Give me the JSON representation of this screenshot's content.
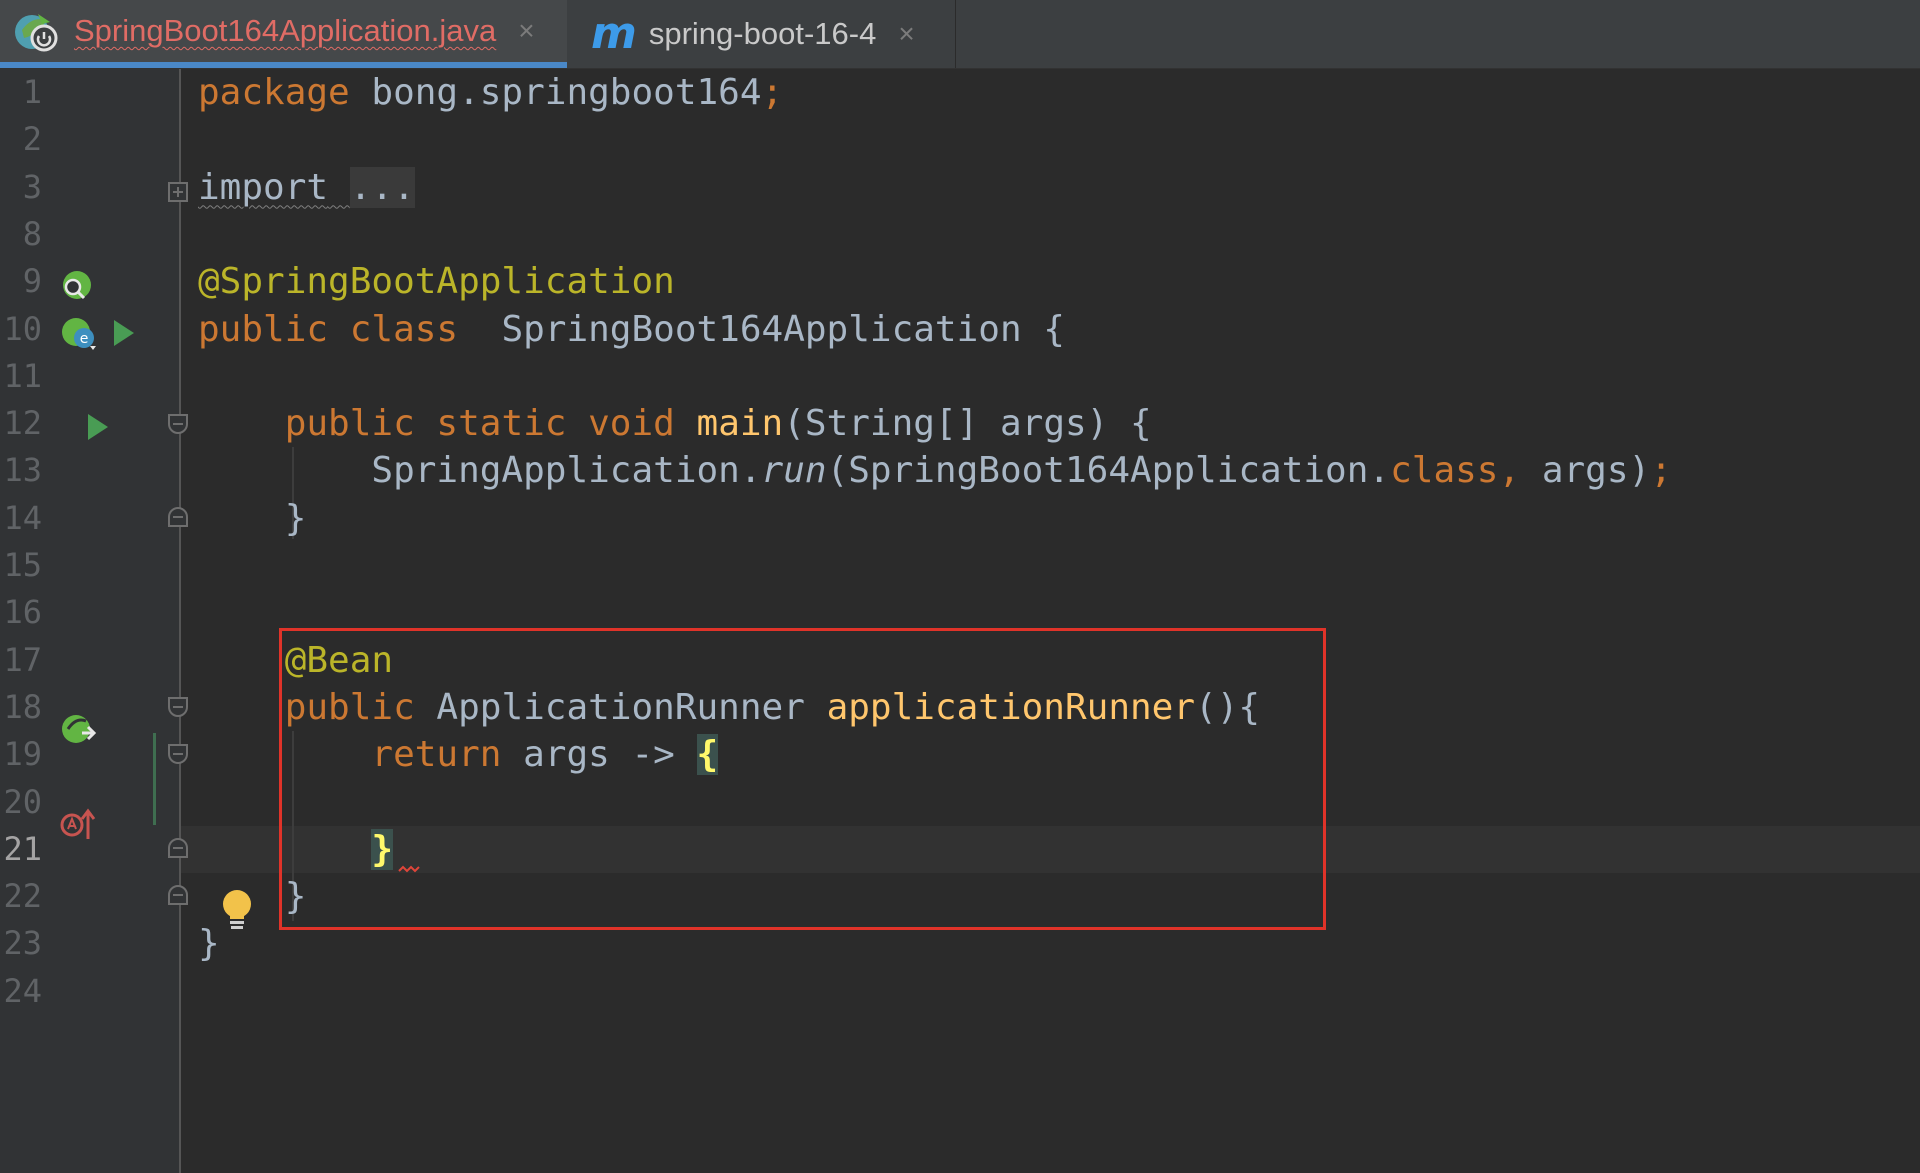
{
  "tabs": [
    {
      "title": "SpringBoot164Application.java",
      "icon": "spring-boot-app-icon",
      "active": true,
      "has_error": true,
      "title_color": "#e06c65"
    },
    {
      "title": "spring-boot-16-4",
      "icon": "maven-m-icon",
      "icon_glyph": "m",
      "active": false
    }
  ],
  "close_glyph": "×",
  "editor": {
    "current_line": 21,
    "line_numbers": [
      "1",
      "2",
      "3",
      "8",
      "9",
      "10",
      "11",
      "12",
      "13",
      "14",
      "15",
      "16",
      "17",
      "18",
      "19",
      "20",
      "21",
      "22",
      "23",
      "24"
    ],
    "code": {
      "l1": {
        "kw": "package",
        "rest": " bong.springboot164",
        "semi": ";"
      },
      "l3": {
        "kw": "import",
        "space": " ",
        "folded": "..."
      },
      "l9": {
        "ann": "@SpringBootApplication"
      },
      "l10": {
        "kw": "public class",
        "rest": "  SpringBoot164Application {"
      },
      "l12": {
        "indent": "    ",
        "kw": "public static void",
        "space": " ",
        "fn": "main",
        "rest": "(String[] args) {"
      },
      "l13": {
        "indent": "        ",
        "a": "SpringApplication.",
        "fn": "run",
        "b": "(SpringBoot164Application.",
        "kw": "class",
        "c": ", ",
        "d": "args)",
        "semi": ";"
      },
      "l14": {
        "text": "    }"
      },
      "l17": {
        "indent": "    ",
        "ann": "@Bean"
      },
      "l18": {
        "indent": "    ",
        "kw": "public",
        "rest": " ApplicationRunner ",
        "fn": "applicationRunner",
        "tail": "(){"
      },
      "l19": {
        "indent": "        ",
        "kw": "return",
        "rest": " args -> ",
        "brace": "{"
      },
      "l21": {
        "indent": "        ",
        "brace": "}"
      },
      "l22": {
        "text": "    }"
      },
      "l23": {
        "text": "}"
      }
    },
    "highlight_box_color": "#e03329"
  }
}
